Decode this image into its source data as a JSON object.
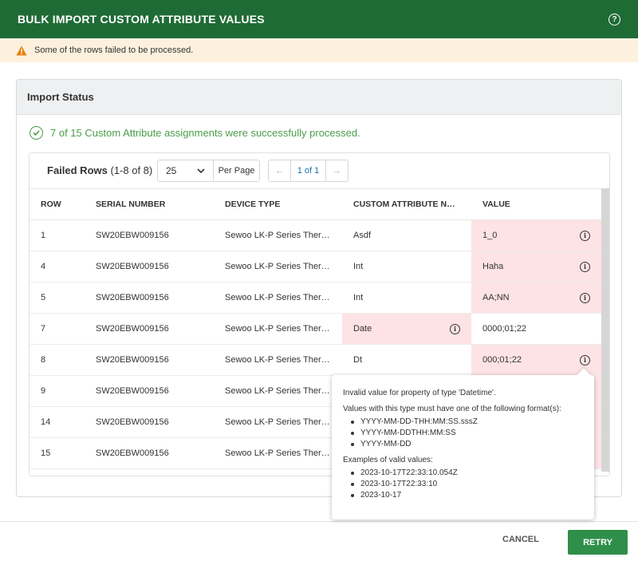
{
  "header": {
    "title": "BULK IMPORT CUSTOM ATTRIBUTE VALUES",
    "help_icon": "help-circle-icon"
  },
  "warning": {
    "text": "Some of the rows failed to be processed.",
    "icon": "warning-triangle-icon",
    "color": "#e8820c"
  },
  "panel": {
    "title": "Import Status",
    "success_text": "7 of 15 Custom Attribute assignments were successfully processed.",
    "success_color": "#4a9e4a"
  },
  "failed": {
    "label": "Failed Rows",
    "range": "(1-8 of 8)",
    "per_page_value": "25",
    "per_page_label": "Per Page",
    "page_indicator": "1 of 1"
  },
  "table": {
    "columns": [
      "ROW",
      "SERIAL NUMBER",
      "DEVICE TYPE",
      "CUSTOM ATTRIBUTE NAME",
      "VALUE"
    ],
    "rows": [
      {
        "row": "1",
        "serial": "SW20EBW009156",
        "device": "Sewoo LK-P Series Thermal Printer",
        "name": "Asdf",
        "value": "1_0"
      },
      {
        "row": "4",
        "serial": "SW20EBW009156",
        "device": "Sewoo LK-P Series Thermal Printer",
        "name": "Int",
        "value": "Haha"
      },
      {
        "row": "5",
        "serial": "SW20EBW009156",
        "device": "Sewoo LK-P Series Thermal Printer",
        "name": "Int",
        "value": "AA;NN"
      },
      {
        "row": "7",
        "serial": "SW20EBW009156",
        "device": "Sewoo LK-P Series Thermal Printer",
        "name": "Date",
        "value": "0000;01;22"
      },
      {
        "row": "8",
        "serial": "SW20EBW009156",
        "device": "Sewoo LK-P Series Thermal Printer",
        "name": "Dt",
        "value": "000;01;22"
      },
      {
        "row": "9",
        "serial": "SW20EBW009156",
        "device": "Sewoo LK-P Series Thermal Printer",
        "name": "",
        "value": ""
      },
      {
        "row": "14",
        "serial": "SW20EBW009156",
        "device": "Sewoo LK-P Series Thermal Printer",
        "name": "",
        "value": ""
      },
      {
        "row": "15",
        "serial": "SW20EBW009156",
        "device": "Sewoo LK-P Series Thermal Printer",
        "name": "",
        "value": ""
      }
    ],
    "error_bg": "#fde3e5"
  },
  "tooltip": {
    "line1": "Invalid value for property of type 'Datetime'.",
    "line2": "Values with this type must have one of the following format(s):",
    "formats": [
      "YYYY-MM-DD-THH:MM:SS.sssZ",
      "YYYY-MM-DDTHH:MM:SS",
      "YYYY-MM-DD"
    ],
    "examples_label": "Examples of valid values:",
    "examples": [
      "2023-10-17T22:33:10.054Z",
      "2023-10-17T22:33:10",
      "2023-10-17"
    ]
  },
  "footer": {
    "cancel": "CANCEL",
    "retry": "RETRY",
    "retry_color": "#2f8f4a"
  },
  "theme": {
    "header_bg": "#1f6b35"
  }
}
